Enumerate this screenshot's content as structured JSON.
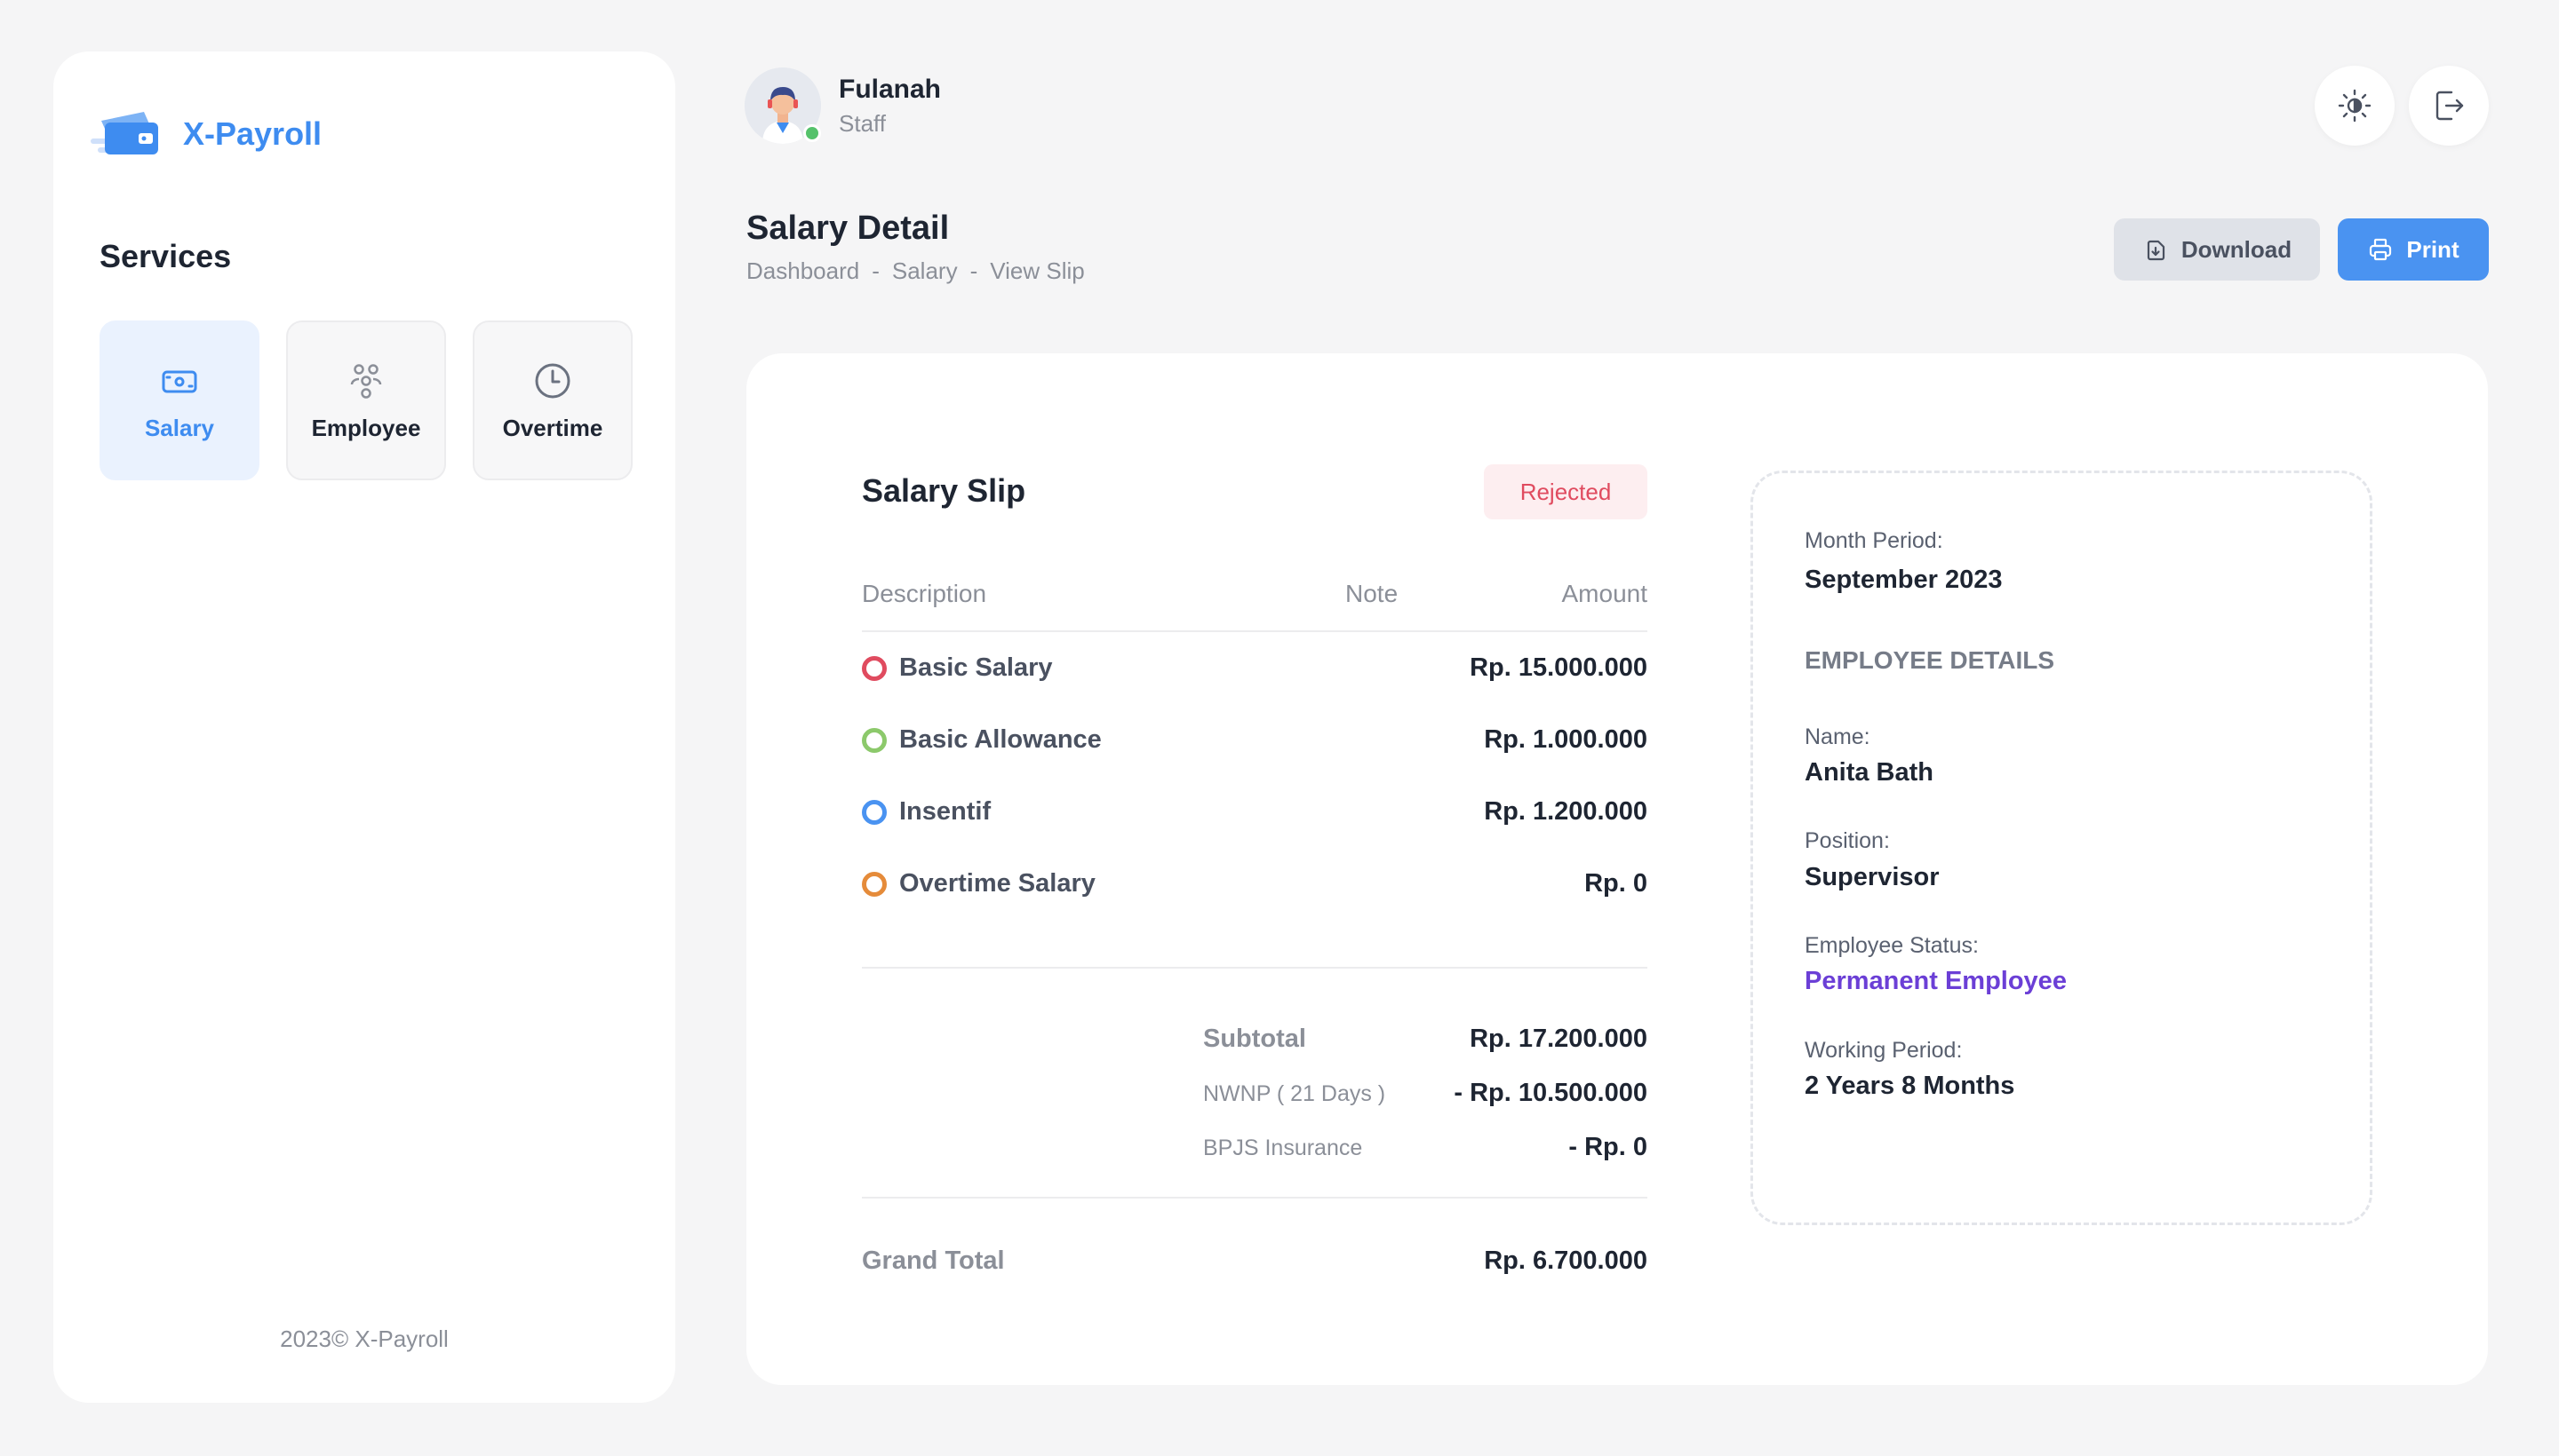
{
  "brand": {
    "name": "X-Payroll"
  },
  "sidebar": {
    "services_title": "Services",
    "tiles": [
      {
        "label": "Salary",
        "icon": "wallet-icon",
        "active": true
      },
      {
        "label": "Employee",
        "icon": "users-icon",
        "active": false
      },
      {
        "label": "Overtime",
        "icon": "clock-icon",
        "active": false
      }
    ],
    "footer": "2023© X-Payroll"
  },
  "user": {
    "name": "Fulanah",
    "role": "Staff",
    "online": true
  },
  "header": {
    "title": "Salary Detail",
    "breadcrumb": [
      "Dashboard",
      "-",
      "Salary",
      "-",
      "View Slip"
    ],
    "download_label": "Download",
    "print_label": "Print"
  },
  "slip": {
    "title": "Salary Slip",
    "status": "Rejected",
    "columns": {
      "description": "Description",
      "note": "Note",
      "amount": "Amount"
    },
    "rows": [
      {
        "description": "Basic Salary",
        "note": "",
        "amount": "Rp. 15.000.000",
        "color": "#e04b5f"
      },
      {
        "description": "Basic Allowance",
        "note": "",
        "amount": "Rp. 1.000.000",
        "color": "#8cc96b"
      },
      {
        "description": "Insentif",
        "note": "",
        "amount": "Rp. 1.200.000",
        "color": "#4a93f1"
      },
      {
        "description": "Overtime Salary",
        "note": "",
        "amount": "Rp. 0",
        "color": "#e58b3a"
      }
    ],
    "subtotal_label": "Subtotal",
    "subtotal_value": "Rp. 17.200.000",
    "nwnp_label": "NWNP ( 21 Days )",
    "nwnp_value": "- Rp. 10.500.000",
    "bpjs_label": "BPJS Insurance",
    "bpjs_value": "- Rp. 0",
    "grand_total_label": "Grand Total",
    "grand_total_value": "Rp. 6.700.000"
  },
  "details": {
    "month_period_label": "Month Period:",
    "month_period_value": "September 2023",
    "section_title": "EMPLOYEE DETAILS",
    "name_label": "Name:",
    "name_value": "Anita Bath",
    "position_label": "Position:",
    "position_value": "Supervisor",
    "status_label": "Employee Status:",
    "status_value": "Permanent Employee",
    "working_period_label": "Working Period:",
    "working_period_value": "2 Years 8 Months"
  },
  "colors": {
    "accent": "#3e8cf0",
    "rejected": "#e04b5f",
    "permanent": "#6b3fd6"
  }
}
